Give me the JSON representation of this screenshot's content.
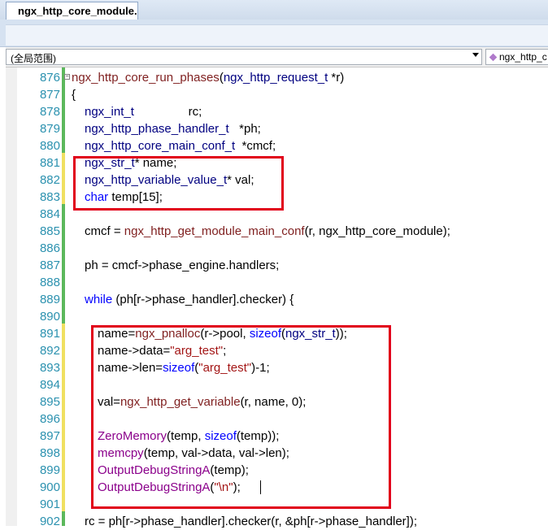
{
  "tab": {
    "title": "ngx_http_core_module.c"
  },
  "navbar": {
    "scope": "(全局范围)",
    "member": "ngx_http_c"
  },
  "code_lines": [
    {
      "num": "876",
      "parts": [
        [
          "f",
          "ngx_http_core_run_phases"
        ],
        [
          "p",
          "("
        ],
        [
          "t",
          "ngx_http_request_t"
        ],
        [
          "p",
          " *r)"
        ]
      ]
    },
    {
      "num": "877",
      "parts": [
        [
          "p",
          "{"
        ]
      ]
    },
    {
      "num": "878",
      "parts": [
        [
          "t",
          "ngx_int_t"
        ],
        [
          "p",
          "                rc;"
        ]
      ]
    },
    {
      "num": "879",
      "parts": [
        [
          "t",
          "ngx_http_phase_handler_t"
        ],
        [
          "p",
          "   *ph;"
        ]
      ]
    },
    {
      "num": "880",
      "parts": [
        [
          "t",
          "ngx_http_core_main_conf_t"
        ],
        [
          "p",
          "  *cmcf;"
        ]
      ]
    },
    {
      "num": "881",
      "parts": [
        [
          "t",
          "ngx_str_t"
        ],
        [
          "p",
          "* name;"
        ]
      ]
    },
    {
      "num": "882",
      "parts": [
        [
          "t",
          "ngx_http_variable_value_t"
        ],
        [
          "p",
          "* val;"
        ]
      ]
    },
    {
      "num": "883",
      "parts": [
        [
          "k",
          "char"
        ],
        [
          "p",
          " temp[15];"
        ]
      ]
    },
    {
      "num": "884",
      "parts": []
    },
    {
      "num": "885",
      "parts": [
        [
          "p",
          "cmcf = "
        ],
        [
          "f",
          "ngx_http_get_module_main_conf"
        ],
        [
          "p",
          "(r, ngx_http_core_module);"
        ]
      ]
    },
    {
      "num": "886",
      "parts": []
    },
    {
      "num": "887",
      "parts": [
        [
          "p",
          "ph = cmcf->phase_engine.handlers;"
        ]
      ]
    },
    {
      "num": "888",
      "parts": []
    },
    {
      "num": "889",
      "parts": [
        [
          "k",
          "while"
        ],
        [
          "p",
          " (ph[r->phase_handler].checker) {"
        ]
      ]
    },
    {
      "num": "890",
      "parts": []
    },
    {
      "num": "891",
      "parts": [
        [
          "p",
          "name="
        ],
        [
          "f",
          "ngx_pnalloc"
        ],
        [
          "p",
          "(r->pool, "
        ],
        [
          "k",
          "sizeof"
        ],
        [
          "p",
          "("
        ],
        [
          "t",
          "ngx_str_t"
        ],
        [
          "p",
          "));"
        ]
      ]
    },
    {
      "num": "892",
      "parts": [
        [
          "p",
          "name->data="
        ],
        [
          "s",
          "\"arg_test\""
        ],
        [
          "p",
          ";"
        ]
      ]
    },
    {
      "num": "893",
      "parts": [
        [
          "p",
          "name->len="
        ],
        [
          "k",
          "sizeof"
        ],
        [
          "p",
          "("
        ],
        [
          "s",
          "\"arg_test\""
        ],
        [
          "p",
          ")-1;"
        ]
      ]
    },
    {
      "num": "894",
      "parts": []
    },
    {
      "num": "895",
      "parts": [
        [
          "p",
          "val="
        ],
        [
          "f",
          "ngx_http_get_variable"
        ],
        [
          "p",
          "(r, name, 0);"
        ]
      ]
    },
    {
      "num": "896",
      "parts": []
    },
    {
      "num": "897",
      "parts": [
        [
          "m",
          "ZeroMemory"
        ],
        [
          "p",
          "(temp, "
        ],
        [
          "k",
          "sizeof"
        ],
        [
          "p",
          "(temp));"
        ]
      ]
    },
    {
      "num": "898",
      "parts": [
        [
          "m",
          "memcpy"
        ],
        [
          "p",
          "(temp, val->data, val->len);"
        ]
      ]
    },
    {
      "num": "899",
      "parts": [
        [
          "m",
          "OutputDebugStringA"
        ],
        [
          "p",
          "(temp);"
        ]
      ]
    },
    {
      "num": "900",
      "parts": [
        [
          "m",
          "OutputDebugStringA"
        ],
        [
          "p",
          "("
        ],
        [
          "s",
          "\"\\n\""
        ],
        [
          "p",
          ");"
        ]
      ]
    },
    {
      "num": "901",
      "parts": []
    },
    {
      "num": "902",
      "parts": [
        [
          "p",
          "rc = ph[r->phase_handler].checker(r, &ph[r->phase_handler]);"
        ]
      ]
    }
  ],
  "colors": {
    "keyword": "#0000ff",
    "type": "#000080",
    "function": "#7f1f1f",
    "macro": "#8b008b",
    "string": "#a31515",
    "line_number": "#2b91af",
    "highlight_box": "#e1001a",
    "changed_saved": "#5cb85c",
    "changed_unsaved": "#f0e060"
  },
  "icons": {
    "fold": "collapse-box-icon",
    "member": "member-icon",
    "dropdown": "chevron-down-icon"
  }
}
